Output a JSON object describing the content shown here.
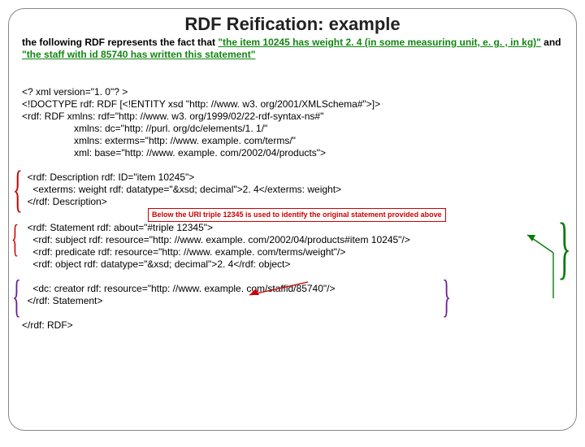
{
  "title": "RDF Reification: example",
  "intro": {
    "prefix": "the following RDF represents the fact that ",
    "quote1": "\"the item 10245 has weight 2. 4 (in some measuring unit, e. g. ,  in kg)\"",
    "mid": " and ",
    "quote2": "\"the staff with id 85740 has written this statement\""
  },
  "xml": {
    "decl": "<? xml version=\"1. 0\"? >",
    "doctype": "<!DOCTYPE rdf: RDF [<!ENTITY xsd \"http: //www. w3. org/2001/XMLSchema#\">]>",
    "root_open": "<rdf: RDF xmlns: rdf=\"http: //www. w3. org/1999/02/22-rdf-syntax-ns#\"",
    "ns_dc": "xmlns: dc=\"http: //purl. org/dc/elements/1. 1/\"",
    "ns_ext": "xmlns: exterms=\"http: //www. example. com/terms/\"",
    "ns_base": "xml: base=\"http: //www. example. com/2002/04/products\">",
    "desc_open": "<rdf: Description rdf: ID=\"item 10245\">",
    "desc_weight": "<exterms: weight rdf: datatype=\"&xsd; decimal\">2. 4</exterms: weight>",
    "desc_close": "</rdf: Description>",
    "note": "Below the URI triple 12345 is used to identify the original statement provided above",
    "stmt_open": "<rdf: Statement rdf: about=\"#triple 12345\">",
    "stmt_subj": "<rdf: subject rdf: resource=\"http: //www. example. com/2002/04/products#item 10245\"/>",
    "stmt_pred": "<rdf: predicate rdf: resource=\"http: //www. example. com/terms/weight\"/>",
    "stmt_obj": "<rdf: object rdf: datatype=\"&xsd; decimal\">2. 4</rdf: object>",
    "stmt_creator": "<dc: creator rdf: resource=\"http: //www. example. com/staffid/85740\"/>",
    "stmt_close": "</rdf: Statement>",
    "root_close": "</rdf: RDF>"
  }
}
